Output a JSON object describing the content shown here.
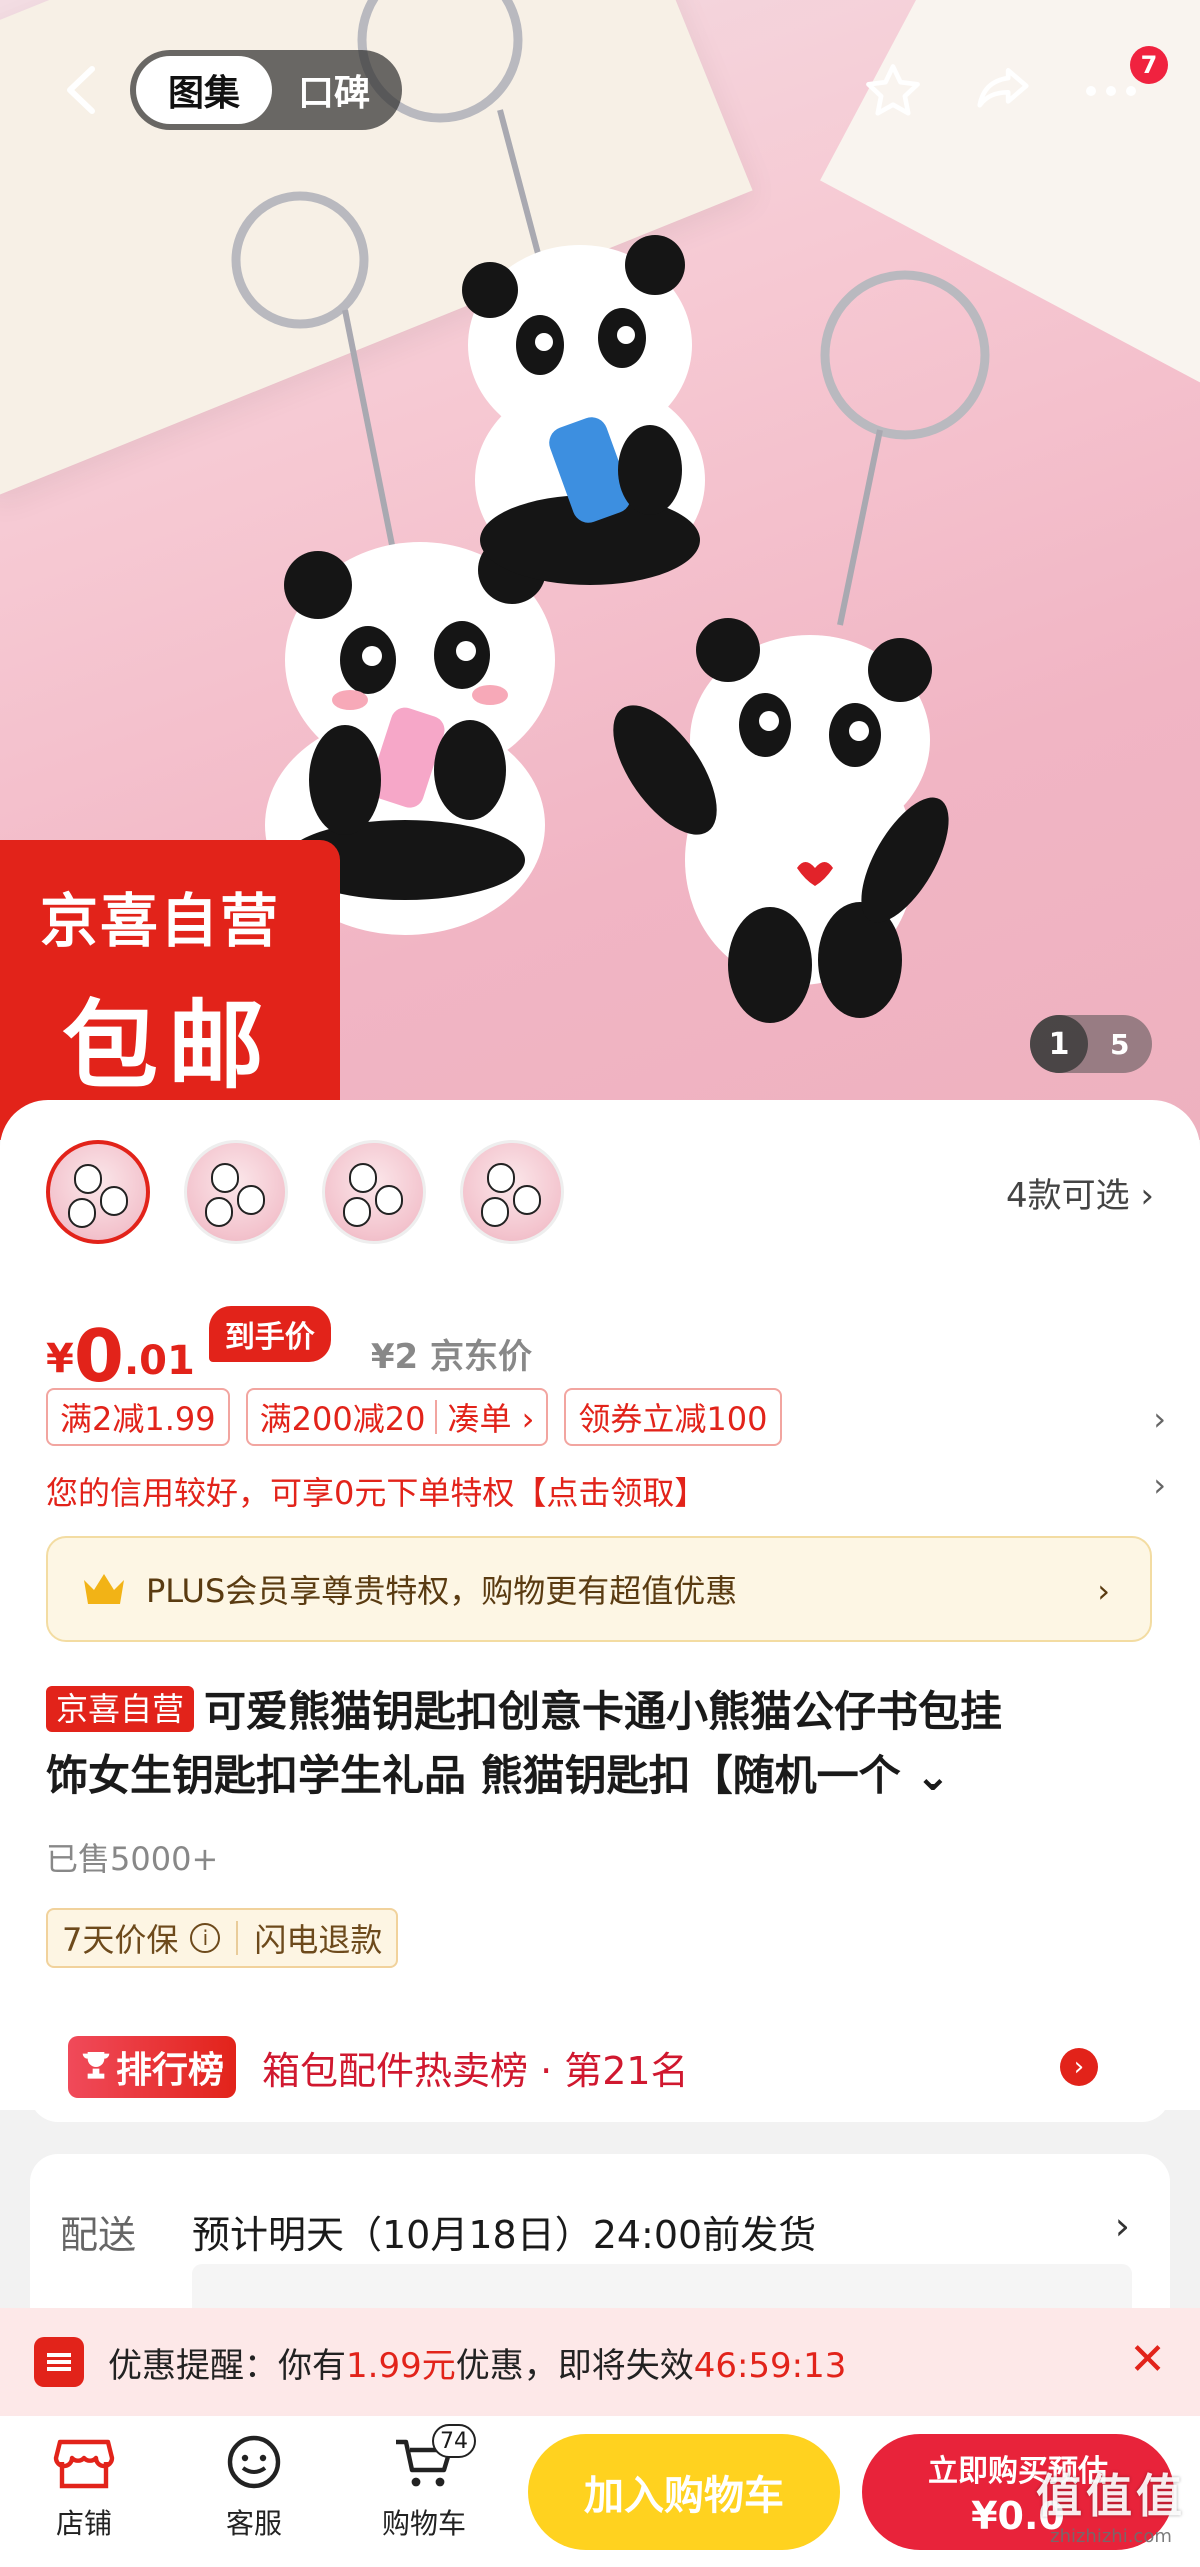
{
  "top_bar": {
    "tabs": [
      {
        "label": "图集",
        "active": true
      },
      {
        "label": "口碑",
        "active": false
      }
    ],
    "notification_count": "7"
  },
  "hero": {
    "promo_line1": "京喜自营",
    "promo_line2": "包邮",
    "page_current": "1",
    "page_total": "5"
  },
  "variants": {
    "count_label": "4款可选",
    "thumb_count": 4,
    "selected_index": 0
  },
  "price": {
    "symbol": "¥",
    "integer": "0",
    "decimal": ".01",
    "tag": "到手价",
    "jd_price": "¥2 京东价"
  },
  "coupons": {
    "items": [
      "满2减1.99",
      "满200减20",
      "凑单 ›",
      "领券立减100"
    ],
    "credit_text": "您的信用较好，可享0元下单特权【点击领取】"
  },
  "plus": {
    "text": "PLUS会员享尊贵特权，购物更有超值优惠"
  },
  "product": {
    "tag": "京喜自营",
    "title_line1": "可爱熊猫钥匙扣创意卡通小熊猫公仔书包挂",
    "title_line2": "饰女生钥匙扣学生礼品 熊猫钥匙扣【随机一个 ⌄",
    "sold": "已售5000+",
    "guarantee_1": "7天价保",
    "guarantee_2": "闪电退款"
  },
  "rank": {
    "badge": "排行榜",
    "text": "箱包配件热卖榜 · 第21名"
  },
  "delivery": {
    "label": "配送",
    "text": "预计明天（10月18日）24:00前发货"
  },
  "notice": {
    "prefix": "优惠提醒：你有",
    "amount": "1.99元",
    "middle": "优惠，即将失效",
    "countdown": "46:59:13"
  },
  "bottom": {
    "store": "店铺",
    "service": "客服",
    "cart": "购物车",
    "cart_count": "74",
    "add_cart": "加入购物车",
    "buy_now": "立即购买预估",
    "buy_price": "¥0.0",
    "watermark_logo": "值值值",
    "watermark_url": "zhizhizhi.com"
  },
  "colors": {
    "brand_red": "#e2231a",
    "cart_yellow": "#ffd21f",
    "buy_red": "#e8233a",
    "plus_bg": "#fdf6e4"
  }
}
